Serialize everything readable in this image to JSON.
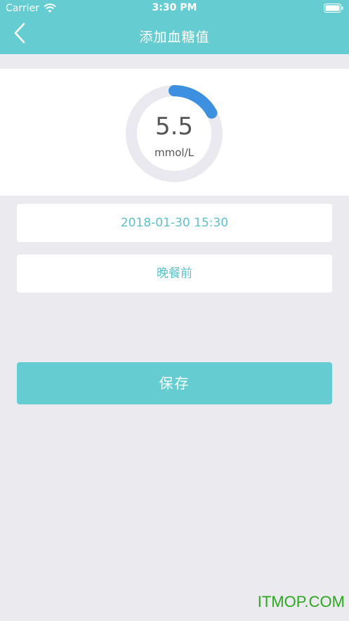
{
  "status_bar": {
    "carrier": "Carrier",
    "time": "3:30 PM"
  },
  "nav": {
    "title": "添加血糖值"
  },
  "gauge": {
    "value": "5.5",
    "unit": "mmol/L",
    "fill_fraction": 0.17,
    "track_color": "#e9e9ef",
    "fill_color": "#3d8fe0"
  },
  "fields": {
    "datetime": "2018-01-30 15:30",
    "period": "晚餐前"
  },
  "actions": {
    "save_label": "保存"
  },
  "watermark": "ITMOP.COM",
  "colors": {
    "brand": "#65cdd2",
    "field_text": "#5bc2c9",
    "background": "#ebeaef"
  }
}
